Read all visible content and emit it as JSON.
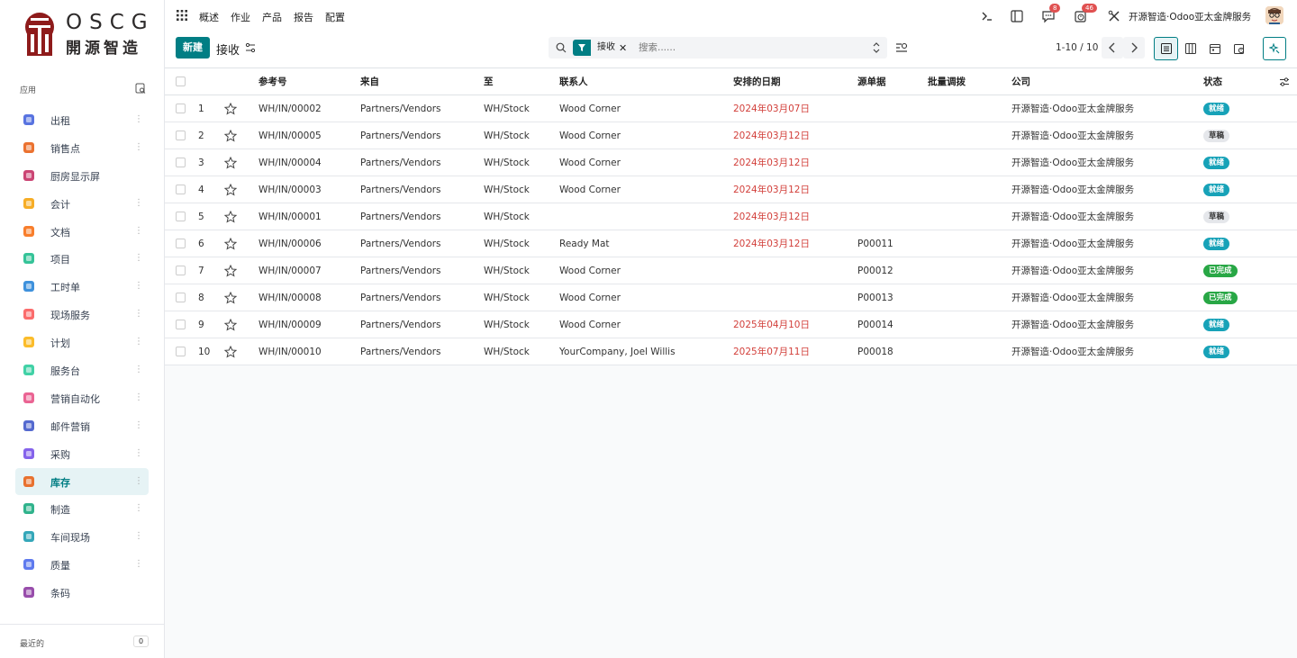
{
  "logo": {
    "text_top": "OSCG",
    "text_bottom": "開源智造"
  },
  "sidebar": {
    "apps_title": "应用",
    "recent_title": "最近的",
    "recent_count": "0",
    "items": [
      {
        "label": "出租",
        "icon": "rental-icon",
        "color": "#3b5bdb",
        "more": true
      },
      {
        "label": "销售点",
        "icon": "pos-icon",
        "color": "#e8590c",
        "more": true
      },
      {
        "label": "厨房显示屏",
        "icon": "kitchen-display-icon",
        "color": "#c2255c",
        "more": false
      },
      {
        "label": "会计",
        "icon": "accounting-icon",
        "color": "#f59f00",
        "more": true
      },
      {
        "label": "文档",
        "icon": "documents-icon",
        "color": "#f76707",
        "more": true
      },
      {
        "label": "项目",
        "icon": "project-icon",
        "color": "#12b886",
        "more": true
      },
      {
        "label": "工时单",
        "icon": "timesheet-icon",
        "color": "#1c7ed6",
        "more": true
      },
      {
        "label": "现场服务",
        "icon": "field-service-icon",
        "color": "#fa5252",
        "more": true
      },
      {
        "label": "计划",
        "icon": "planning-icon",
        "color": "#fab005",
        "more": true
      },
      {
        "label": "服务台",
        "icon": "helpdesk-icon",
        "color": "#20c997",
        "more": true
      },
      {
        "label": "营销自动化",
        "icon": "marketing-automation-icon",
        "color": "#e64980",
        "more": true
      },
      {
        "label": "邮件营销",
        "icon": "email-marketing-icon",
        "color": "#364fc7",
        "more": true
      },
      {
        "label": "采购",
        "icon": "purchase-icon",
        "color": "#7048e8",
        "more": true
      },
      {
        "label": "库存",
        "icon": "inventory-icon",
        "color": "#e8590c",
        "more": true,
        "active": true
      },
      {
        "label": "制造",
        "icon": "manufacturing-icon",
        "color": "#0ca678",
        "more": true
      },
      {
        "label": "车间现场",
        "icon": "shop-floor-icon",
        "color": "#1098ad",
        "more": true
      },
      {
        "label": "质量",
        "icon": "quality-icon",
        "color": "#4263eb",
        "more": true
      },
      {
        "label": "条码",
        "icon": "barcode-icon",
        "color": "#862e9c",
        "more": false
      }
    ]
  },
  "topbar": {
    "menu": [
      "概述",
      "作业",
      "产品",
      "报告",
      "配置"
    ],
    "messages_count": "8",
    "activities_count": "46",
    "company": "开源智造·Odoo亚太金牌服务"
  },
  "control": {
    "new_label": "新建",
    "breadcrumb": "接收",
    "facet_label": "接收",
    "search_placeholder": "搜索......",
    "pager": "1-10 / 10"
  },
  "table": {
    "columns": [
      "参考号",
      "来自",
      "至",
      "联系人",
      "安排的日期",
      "源单据",
      "批量调拨",
      "公司",
      "状态"
    ],
    "rows": [
      {
        "num": "1",
        "ref": "WH/IN/00002",
        "from": "Partners/Vendors",
        "to": "WH/Stock",
        "contact": "Wood Corner",
        "date": "2024年03月07日",
        "source": "",
        "batch": "",
        "company": "开源智造·Odoo亚太金牌服务",
        "status": "就绪",
        "status_kind": "ready"
      },
      {
        "num": "2",
        "ref": "WH/IN/00005",
        "from": "Partners/Vendors",
        "to": "WH/Stock",
        "contact": "Wood Corner",
        "date": "2024年03月12日",
        "source": "",
        "batch": "",
        "company": "开源智造·Odoo亚太金牌服务",
        "status": "草稿",
        "status_kind": "draft"
      },
      {
        "num": "3",
        "ref": "WH/IN/00004",
        "from": "Partners/Vendors",
        "to": "WH/Stock",
        "contact": "Wood Corner",
        "date": "2024年03月12日",
        "source": "",
        "batch": "",
        "company": "开源智造·Odoo亚太金牌服务",
        "status": "就绪",
        "status_kind": "ready"
      },
      {
        "num": "4",
        "ref": "WH/IN/00003",
        "from": "Partners/Vendors",
        "to": "WH/Stock",
        "contact": "Wood Corner",
        "date": "2024年03月12日",
        "source": "",
        "batch": "",
        "company": "开源智造·Odoo亚太金牌服务",
        "status": "就绪",
        "status_kind": "ready"
      },
      {
        "num": "5",
        "ref": "WH/IN/00001",
        "from": "Partners/Vendors",
        "to": "WH/Stock",
        "contact": "",
        "date": "2024年03月12日",
        "source": "",
        "batch": "",
        "company": "开源智造·Odoo亚太金牌服务",
        "status": "草稿",
        "status_kind": "draft"
      },
      {
        "num": "6",
        "ref": "WH/IN/00006",
        "from": "Partners/Vendors",
        "to": "WH/Stock",
        "contact": "Ready Mat",
        "date": "2024年03月12日",
        "source": "P00011",
        "batch": "",
        "company": "开源智造·Odoo亚太金牌服务",
        "status": "就绪",
        "status_kind": "ready"
      },
      {
        "num": "7",
        "ref": "WH/IN/00007",
        "from": "Partners/Vendors",
        "to": "WH/Stock",
        "contact": "Wood Corner",
        "date": "",
        "source": "P00012",
        "batch": "",
        "company": "开源智造·Odoo亚太金牌服务",
        "status": "已完成",
        "status_kind": "done"
      },
      {
        "num": "8",
        "ref": "WH/IN/00008",
        "from": "Partners/Vendors",
        "to": "WH/Stock",
        "contact": "Wood Corner",
        "date": "",
        "source": "P00013",
        "batch": "",
        "company": "开源智造·Odoo亚太金牌服务",
        "status": "已完成",
        "status_kind": "done"
      },
      {
        "num": "9",
        "ref": "WH/IN/00009",
        "from": "Partners/Vendors",
        "to": "WH/Stock",
        "contact": "Wood Corner",
        "date": "2025年04月10日",
        "source": "P00014",
        "batch": "",
        "company": "开源智造·Odoo亚太金牌服务",
        "status": "就绪",
        "status_kind": "ready"
      },
      {
        "num": "10",
        "ref": "WH/IN/00010",
        "from": "Partners/Vendors",
        "to": "WH/Stock",
        "contact": "YourCompany, Joel Willis",
        "date": "2025年07月11日",
        "source": "P00018",
        "batch": "",
        "company": "开源智造·Odoo亚太金牌服务",
        "status": "就绪",
        "status_kind": "ready"
      }
    ]
  },
  "colors": {
    "primary": "#017e84",
    "overdue": "#d23f3a",
    "ready": "#17a2b8",
    "done": "#28a745",
    "badge": "#e05151"
  }
}
